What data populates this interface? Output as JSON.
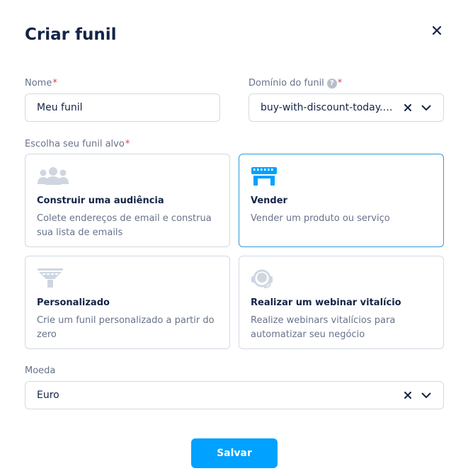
{
  "dialog": {
    "title": "Criar funil"
  },
  "fields": {
    "name": {
      "label": "Nome",
      "value": "Meu funil"
    },
    "domain": {
      "label": "Domínio do funil",
      "help": "?",
      "value": "buy-with-discount-today.systeme.io"
    },
    "target": {
      "label": "Escolha seu funil alvo"
    },
    "currency": {
      "label": "Moeda",
      "value": "Euro"
    }
  },
  "cards": [
    {
      "title": "Construir uma audiência",
      "desc": "Colete endereços de email e construa sua lista de emails",
      "icon": "audience-icon",
      "selected": false
    },
    {
      "title": "Vender",
      "desc": "Vender um produto ou serviço",
      "icon": "store-icon",
      "selected": true
    },
    {
      "title": "Personalizado",
      "desc": "Crie um funil personalizado a partir do zero",
      "icon": "funnel-icon",
      "selected": false
    },
    {
      "title": "Realizar um webinar vitalício",
      "desc": "Realize webinars vitalícios para automatizar seu negócio",
      "icon": "webinar-icon",
      "selected": false
    }
  ],
  "required_mark": "*",
  "save_label": "Salvar",
  "colors": {
    "accent": "#00a1ff",
    "selected_border": "#2f9bd7",
    "title": "#142447",
    "muted": "#67738a",
    "required": "#e53d4e"
  }
}
